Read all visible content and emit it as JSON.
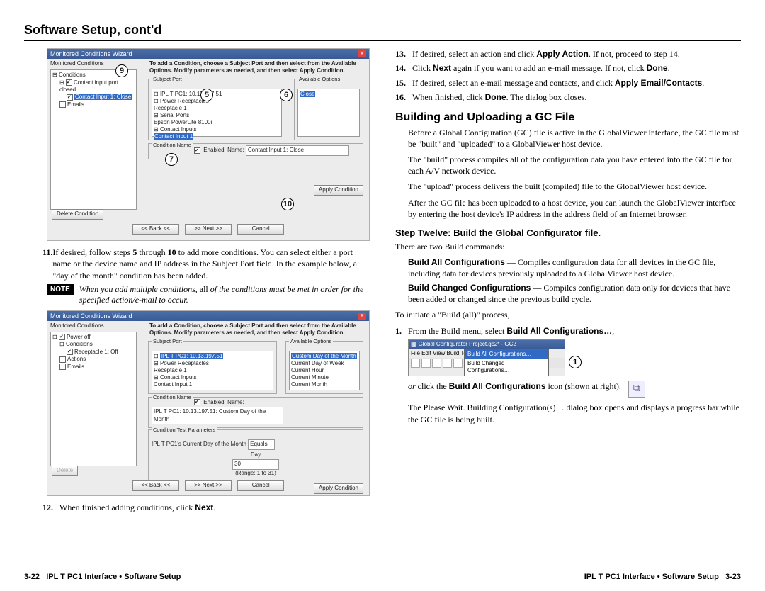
{
  "title": "Software Setup, cont'd",
  "left": {
    "shot1": {
      "window_title": "Monitored Conditions Wizard",
      "panel_label": "Monitored Conditions",
      "tree_root": "Conditions",
      "tree_item_1": "Contact input port closed",
      "tree_item_2": "Contact Input 1: Close",
      "tree_item_3": "Emails",
      "instruction": "To add a Condition, choose a Subject Port and then select from the Available Options. Modify parameters as needed, and then select Apply Condition.",
      "subject_port_label": "Subject Port",
      "subject_port_items": [
        "IPL T PC1: 10.13.197.51",
        "Power Receptacles",
        "Receptacle 1",
        "Serial Ports",
        "Epson PowerLite 8100i",
        "Contact Inputs",
        "Contact Input 1"
      ],
      "available_options_label": "Available Options",
      "available_option": "Close",
      "condition_name_label": "Condition Name",
      "enabled_label": "Enabled",
      "name_label": "Name:",
      "name_value": "Contact Input 1: Close",
      "delete_btn": "Delete Condition",
      "apply_btn": "Apply Condition",
      "back_btn": "<< Back <<",
      "next_btn": ">> Next >>",
      "cancel_btn": "Cancel",
      "callouts": {
        "c9": "9",
        "c5": "5",
        "c6": "6",
        "c7": "7",
        "c10": "10"
      }
    },
    "step11_num": "11.",
    "step11": "If desired, follow steps 5 through 10 to add more conditions.  You can select either a port name or the device name and IP address in the Subject Port field.  In the example below, a \"day of the month\" condition has been added.",
    "step11_b1": "5",
    "step11_b2": "10",
    "note_label": "NOTE",
    "note": "When you add multiple conditions, all of the conditions must be met in order for the specified action/e-mail to occur.",
    "note_ital_all": "all",
    "shot2": {
      "window_title": "Monitored Conditions Wizard",
      "panel_label": "Monitored Conditions",
      "tree_items": [
        "Power off",
        "Conditions",
        "Receptacle 1: Off",
        "Actions",
        "Emails"
      ],
      "instruction": "To add a Condition, choose a Subject Port and then select from the Available Options. Modify parameters as needed, and then select Apply Condition.",
      "subject_port_label": "Subject Port",
      "subject_items": [
        "IPL T PC1: 10.13.197.51",
        "Power Receptacles",
        "Receptacle 1",
        "Contact Inputs",
        "Contact Input 1"
      ],
      "available_options_label": "Available Options",
      "available_items": [
        "Custom Day of the Month",
        "Current Day of Week",
        "Current Hour",
        "Current Minute",
        "Current Month"
      ],
      "condition_name_label": "Condition Name",
      "enabled_label": "Enabled",
      "name_label": "Name:",
      "name_value": "IPL T PC1: 10.13.197.51: Custom Day of the Month",
      "test_label": "Condition Test Parameters",
      "test_field_label": "IPL T PC1's Current Day of the Month",
      "equals": "Equals",
      "day": "Day",
      "day_val": "30",
      "range": "(Range: 1 to 31)",
      "apply_btn": "Apply Condition",
      "delete_btn": "Delete",
      "back_btn": "<< Back <<",
      "next_btn": ">> Next >>",
      "cancel_btn": "Cancel"
    },
    "step12_num": "12.",
    "step12": "When finished adding conditions, click Next.",
    "step12_bold": "Next"
  },
  "right": {
    "step13_num": "13.",
    "step13_a": "If desired, select an action and click ",
    "step13_b": "Apply Action",
    "step13_c": ".  If not, proceed to step 14.",
    "step14_num": "14.",
    "step14_a": "Click ",
    "step14_b": "Next",
    "step14_c": " again if you want to add an e-mail message.  If not, click ",
    "step14_d": "Done",
    "step14_e": ".",
    "step15_num": "15.",
    "step15_a": "If desired, select an e-mail message and contacts, and click ",
    "step15_b": "Apply Email/Contacts",
    "step15_c": ".",
    "step16_num": "16.",
    "step16_a": "When finished, click ",
    "step16_b": "Done",
    "step16_c": ".  The dialog box closes.",
    "h2": "Building and Uploading a GC File",
    "p1": "Before a Global Configuration (GC) file is active in the GlobalViewer interface, the GC file must be \"built\" and \"uploaded\" to a GlobalViewer host device.",
    "p2": "The \"build\" process compiles all of the configuration data you have entered into the GC file for each A/V network device.",
    "p3": "The \"upload\" process delivers the built (compiled) file to the GlobalViewer host device.",
    "p4": "After the GC file has been uploaded to a host device, you can launch the GlobalViewer interface by entering the host device's IP address in the address field of an Internet browser.",
    "h3": "Step Twelve: Build the Global Configurator file.",
    "p5": "There are two Build commands:",
    "def1_head": "Build All Configurations",
    "def1_body_a": " — Compiles configuration data for ",
    "def1_body_u": "all",
    "def1_body_b": " devices in the GC file, including data for devices previously uploaded to a GlobalViewer host device.",
    "def2_head": "Build Changed Configurations",
    "def2_body": " — Compiles configuration data only for devices that have been added or changed since the previous build cycle.",
    "p6": "To initiate a \"Build (all)\" process,",
    "ol1_num": "1.",
    "ol1_a": "From the Build menu, select ",
    "ol1_b": "Build All Configurations…",
    "ol1_c": ",",
    "gc_title": "Global Configurator Project.gc2* - GC2",
    "gc_menu": "File  Edit  View  Build  Tools  Help",
    "gc_opt1": "Build All Configurations…",
    "gc_opt2": "Build Changed Configurations…",
    "gc_callout": "1",
    "p7_a": "or",
    "p7_b": " click the ",
    "p7_c": "Build All Configurations",
    "p7_d": " icon (shown at right).",
    "p8": "The Please Wait. Building Configuration(s)… dialog box opens and displays a progress bar while the GC file is being built."
  },
  "footer": {
    "left_page": "3-22",
    "left_text": "IPL T PC1 Interface • Software Setup",
    "right_text": "IPL T PC1 Interface • Software Setup",
    "right_page": "3-23"
  }
}
